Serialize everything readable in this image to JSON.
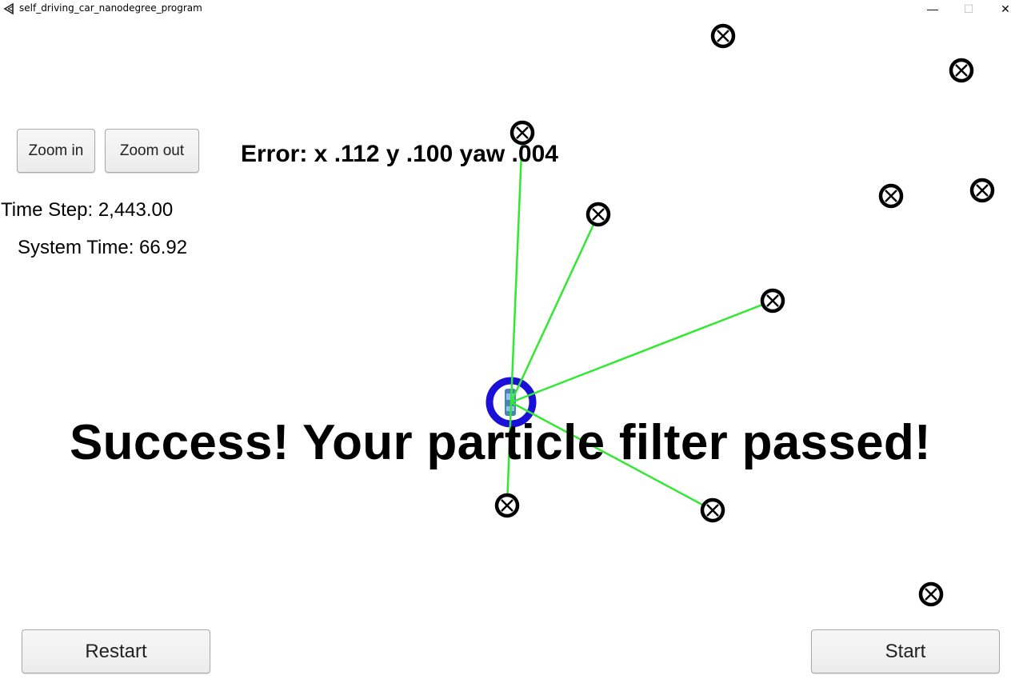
{
  "window": {
    "title": "self_driving_car_nanodegree_program",
    "controls": {
      "minimize": "—",
      "maximize": "☐",
      "close": "✕"
    },
    "app_icon": "unity-icon"
  },
  "controls": {
    "zoom_in_label": "Zoom in",
    "zoom_out_label": "Zoom out",
    "restart_label": "Restart",
    "start_label": "Start"
  },
  "status": {
    "time_step": "Time Step: 2,443.00",
    "system_time": "System Time: 66.92",
    "error": "Error: x .112 y .100 yaw .004",
    "result": "Success! Your particle filter passed!"
  },
  "scene": {
    "landmark_icon": "crossed-circle-icon",
    "vehicle_icon": "car-icon",
    "observation_line_color": "#33e833",
    "vehicle_ring_color": "#1a10d8"
  }
}
